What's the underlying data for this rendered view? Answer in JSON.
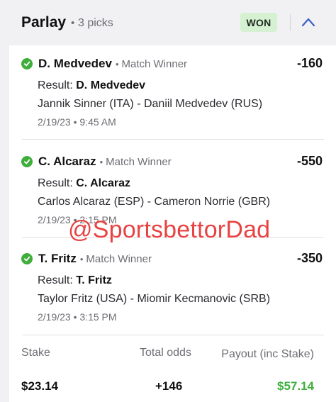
{
  "header": {
    "title": "Parlay",
    "separator": "•",
    "picks_count": "3 picks",
    "status_badge": "WON",
    "collapse_icon": "chevron-up-icon"
  },
  "picks": [
    {
      "selection": "D. Medvedev",
      "market": "Match Winner",
      "odds": "-160",
      "result_label": "Result:",
      "result": "D. Medvedev",
      "matchup": "Jannik Sinner (ITA) - Daniil Medvedev (RUS)",
      "datetime": "2/19/23 • 9:45 AM"
    },
    {
      "selection": "C. Alcaraz",
      "market": "Match Winner",
      "odds": "-550",
      "result_label": "Result:",
      "result": "C. Alcaraz",
      "matchup": "Carlos Alcaraz (ESP) - Cameron Norrie (GBR)",
      "datetime": "2/19/23 • 2:15 PM"
    },
    {
      "selection": "T. Fritz",
      "market": "Match Winner",
      "odds": "-350",
      "result_label": "Result:",
      "result": "T. Fritz",
      "matchup": "Taylor Fritz (USA) - Miomir Kecmanovic (SRB)",
      "datetime": "2/19/23 • 3:15 PM"
    }
  ],
  "summary": {
    "stake_label": "Stake",
    "stake_value": "$23.14",
    "total_odds_label": "Total odds",
    "total_odds_value": "+146",
    "payout_label": "Payout (inc Stake)",
    "payout_value": "$57.14"
  },
  "watermark": "@SportsbettorDad",
  "colors": {
    "win_green": "#3fae3c",
    "badge_bg": "#d6f0d2",
    "accent_blue": "#3b5fc9",
    "watermark_red": "#e84343"
  }
}
